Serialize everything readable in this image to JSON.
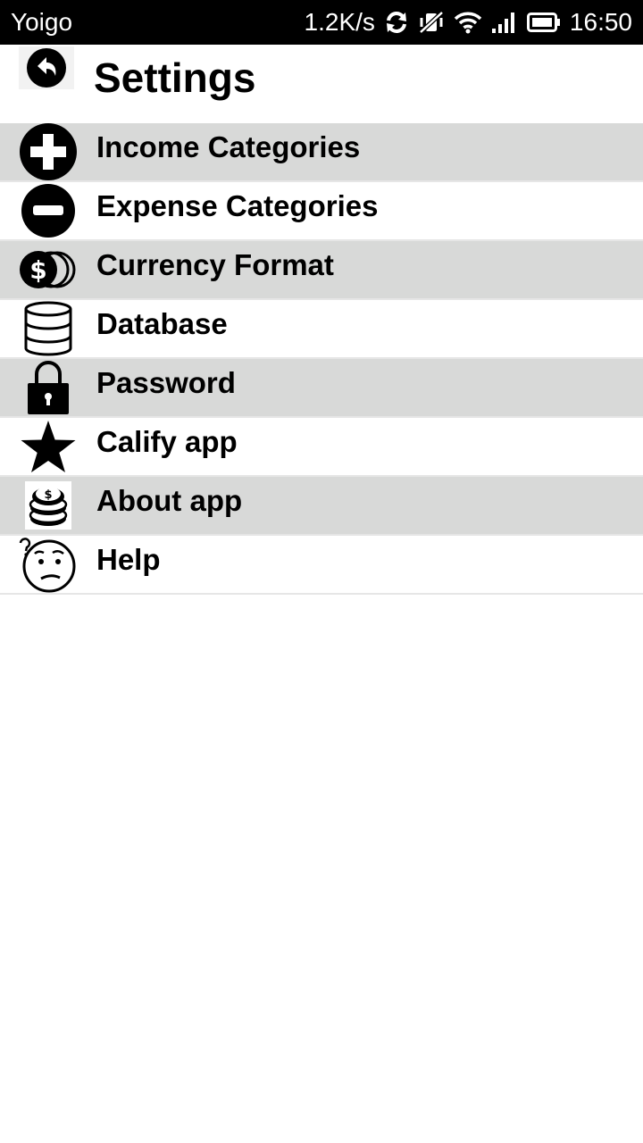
{
  "status_bar": {
    "carrier": "Yoigo",
    "network_speed": "1.2K/s",
    "time": "16:50",
    "icons": [
      "sync-icon",
      "vibrate-off-icon",
      "wifi-icon",
      "signal-icon",
      "battery-icon"
    ]
  },
  "header": {
    "title": "Settings",
    "back_icon": "back-arrow-icon"
  },
  "settings": {
    "items": [
      {
        "label": "Income Categories",
        "icon": "plus-circle-icon"
      },
      {
        "label": "Expense Categories",
        "icon": "minus-circle-icon"
      },
      {
        "label": "Currency Format",
        "icon": "coins-dollar-icon"
      },
      {
        "label": "Database",
        "icon": "database-icon"
      },
      {
        "label": "Password",
        "icon": "lock-icon"
      },
      {
        "label": "Calify app",
        "icon": "star-icon"
      },
      {
        "label": "About app",
        "icon": "coin-stack-icon"
      },
      {
        "label": "Help",
        "icon": "confused-face-icon"
      }
    ]
  },
  "colors": {
    "status_bar_bg": "#000000",
    "row_shaded": "#d8d9d8",
    "row_plain": "#ffffff",
    "text": "#000000"
  }
}
